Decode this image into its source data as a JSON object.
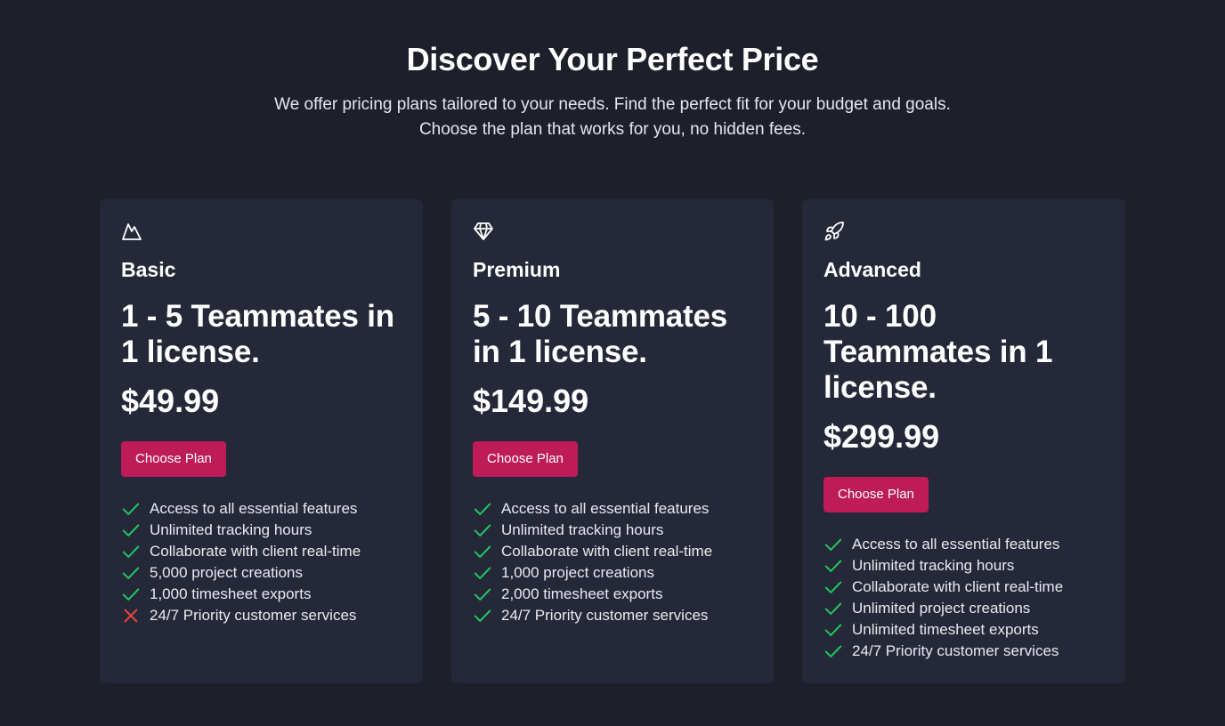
{
  "header": {
    "title": "Discover Your Perfect Price",
    "subtitle_line1": "We offer pricing plans tailored to your needs. Find the perfect fit for your budget and goals.",
    "subtitle_line2": "Choose the plan that works for you, no hidden fees."
  },
  "colors": {
    "background": "#1d1f2b",
    "card": "#252838",
    "button": "#be1c57",
    "check": "#22c55e",
    "cross": "#ef4444"
  },
  "plans": [
    {
      "icon": "mountain-icon",
      "name": "Basic",
      "headline": "1 - 5 Teammates in 1 license.",
      "price": "$49.99",
      "button_label": "Choose Plan",
      "features": [
        {
          "text": "Access to all essential features",
          "included": true
        },
        {
          "text": "Unlimited tracking hours",
          "included": true
        },
        {
          "text": "Collaborate with client real-time",
          "included": true
        },
        {
          "text": "5,000 project creations",
          "included": true
        },
        {
          "text": "1,000 timesheet exports",
          "included": true
        },
        {
          "text": "24/7 Priority customer services",
          "included": false
        }
      ]
    },
    {
      "icon": "diamond-icon",
      "name": "Premium",
      "headline": "5 - 10 Teammates in 1 license.",
      "price": "$149.99",
      "button_label": "Choose Plan",
      "features": [
        {
          "text": "Access to all essential features",
          "included": true
        },
        {
          "text": "Unlimited tracking hours",
          "included": true
        },
        {
          "text": "Collaborate with client real-time",
          "included": true
        },
        {
          "text": "1,000 project creations",
          "included": true
        },
        {
          "text": "2,000 timesheet exports",
          "included": true
        },
        {
          "text": "24/7 Priority customer services",
          "included": true
        }
      ]
    },
    {
      "icon": "rocket-icon",
      "name": "Advanced",
      "headline": "10 - 100 Teammates in 1 license.",
      "price": "$299.99",
      "button_label": "Choose Plan",
      "features": [
        {
          "text": "Access to all essential features",
          "included": true
        },
        {
          "text": "Unlimited tracking hours",
          "included": true
        },
        {
          "text": "Collaborate with client real-time",
          "included": true
        },
        {
          "text": "Unlimited project creations",
          "included": true
        },
        {
          "text": "Unlimited timesheet exports",
          "included": true
        },
        {
          "text": "24/7 Priority customer services",
          "included": true
        }
      ]
    }
  ]
}
